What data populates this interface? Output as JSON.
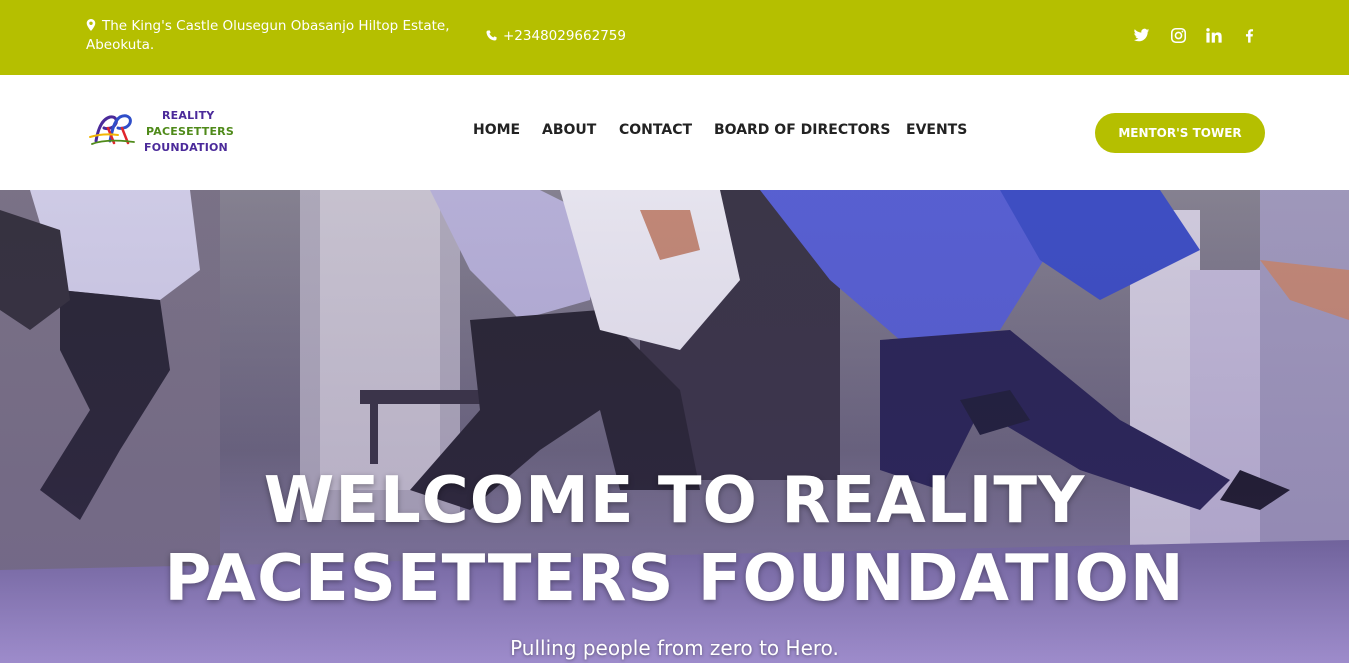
{
  "topbar": {
    "address": "The King's Castle Olusegun Obasanjo Hiltop Estate, Abeokuta.",
    "phone": "+2348029662759",
    "social_icons": [
      "twitter-icon",
      "instagram-icon",
      "linkedin-icon",
      "facebook-icon"
    ]
  },
  "logo": {
    "line1": "REALITY",
    "line2": "PACESETTERS",
    "line3": "FOUNDATION"
  },
  "nav": {
    "items": [
      {
        "label": "HOME"
      },
      {
        "label": "ABOUT"
      },
      {
        "label": "CONTACT"
      },
      {
        "label": "BOARD OF DIRECTORS"
      },
      {
        "label": "EVENTS"
      }
    ],
    "cta_label": "MENTOR'S TOWER"
  },
  "hero": {
    "title_line1": "WELCOME TO REALITY",
    "title_line2": "PACESETTERS FOUNDATION",
    "subtitle": "Pulling people from zero to Hero."
  },
  "colors": {
    "brand": "#b5bf00",
    "nav_text": "#222222",
    "logo_purple": "#4b2a9a",
    "logo_green": "#4f8a1a"
  }
}
